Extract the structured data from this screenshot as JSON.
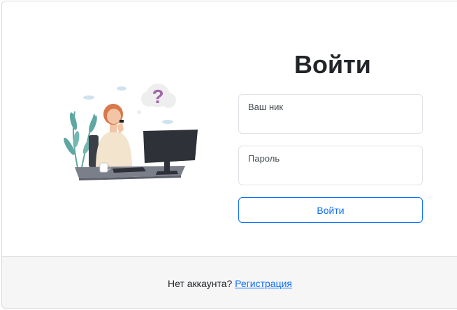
{
  "login": {
    "title": "Войти",
    "nickname_label": "Ваш ник",
    "nickname_value": "",
    "password_label": "Пароль",
    "password_value": "",
    "submit_label": "Войти"
  },
  "footer": {
    "prompt": "Нет аккаунта?",
    "register_link": "Регистрация"
  },
  "illustration": {
    "question_mark": "?"
  },
  "colors": {
    "accent": "#0d6efd",
    "title_text": "#212529",
    "footer_bg": "#f6f6f6",
    "question_mark": "#a166ab",
    "plant": "#5fa7a2",
    "hair": "#d9784a"
  }
}
